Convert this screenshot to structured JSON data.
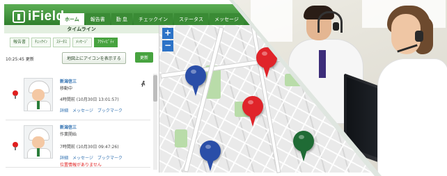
{
  "app": {
    "logo_text": "iField",
    "nav": [
      {
        "label": "ホーム",
        "active": true
      },
      {
        "label": "報告書",
        "active": false
      },
      {
        "label": "勤 怠",
        "active": false
      },
      {
        "label": "チェックイン",
        "active": false
      },
      {
        "label": "ステータス",
        "active": false
      },
      {
        "label": "メッセージ",
        "active": false
      }
    ]
  },
  "panel": {
    "title": "タイムライン",
    "filters": [
      {
        "label": "報告書",
        "active": false
      },
      {
        "label": "ﾁｪｯｸｲﾝ",
        "active": false
      },
      {
        "label": "ｽﾃｰﾀｽ",
        "active": false
      },
      {
        "label": "ﾒｯｾｰｼﾞ",
        "active": false
      },
      {
        "label": "ｱｸﾃｨﾋﾞﾃｨ",
        "active": true
      }
    ],
    "updated": "10:25:45 更新",
    "show_icons_button": "地図上にアイコンを表示する",
    "refresh_button": "更新",
    "entries": [
      {
        "name": "新潟信三",
        "status": "移動中",
        "time": "4時間前 (10月30日 13:01:57)",
        "links": [
          "詳細",
          "メッセージ",
          "ブックマーク"
        ],
        "warning": ""
      },
      {
        "name": "新潟信三",
        "status": "作業開始",
        "time": "7時間前 (10月30日 09:47:26)",
        "links": [
          "詳細",
          "メッセージ",
          "ブックマーク"
        ],
        "warning": "位置情報がありません"
      }
    ]
  },
  "map": {
    "zoom_in": "+",
    "zoom_out": "−",
    "pins": [
      {
        "color": "#2a4ea8"
      },
      {
        "color": "#e0242a"
      },
      {
        "color": "#e0242a"
      },
      {
        "color": "#2a4ea8"
      },
      {
        "color": "#1f6b35"
      }
    ]
  },
  "colors": {
    "brand_green": "#3a8b35",
    "accent_blue": "#2d73c7",
    "warning_red": "#e0201f"
  }
}
